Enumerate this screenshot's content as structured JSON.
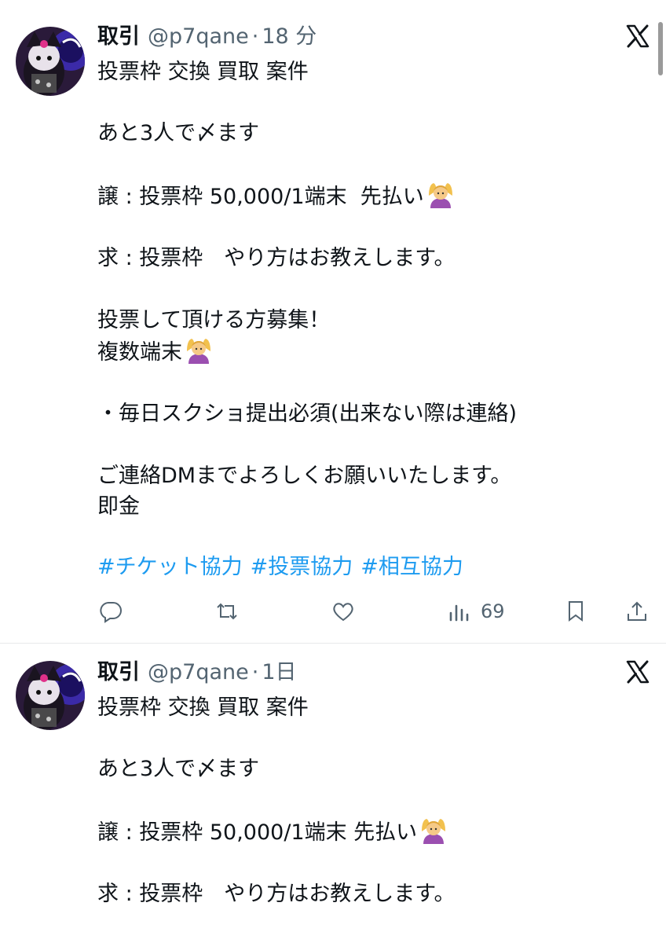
{
  "tweets": [
    {
      "name": "取引",
      "handle": "@p7qane",
      "separator": "·",
      "time": "18 分",
      "lines": [
        "投票枠 交換 買取 案件",
        "",
        "あと3人で〆ます",
        "",
        "譲 : 投票枠 50,000/1端末  先払い",
        "",
        "求 : 投票枠　やり方はお教えします。",
        "",
        "投票して頂ける方募集！",
        "複数端末",
        "",
        "・毎日スクショ提出必須(出来ない際は連絡)",
        "",
        "ご連絡DMまでよろしくお願いいたします。",
        "即金"
      ],
      "hashtags": [
        "#チケット協力",
        "#投票協力",
        "#相互協力"
      ],
      "views": "69"
    },
    {
      "name": "取引",
      "handle": "@p7qane",
      "separator": "·",
      "time": "1日",
      "lines": [
        "投票枠 交換 買取 案件",
        "",
        "あと3人で〆ます",
        "",
        "譲 : 投票枠 50,000/1端末 先払い",
        "",
        "求 : 投票枠　やり方はお教えします。"
      ]
    }
  ],
  "icons": {
    "reply": "reply-icon",
    "retweet": "retweet-icon",
    "like": "like-icon",
    "views": "views-icon",
    "bookmark": "bookmark-icon",
    "share": "share-icon",
    "brand": "x-logo-icon",
    "emoji": "person-gesturing-ok-emoji"
  },
  "colors": {
    "text": "#0f1419",
    "muted": "#536471",
    "link": "#1d9bf0",
    "divider": "#e7e9ea"
  }
}
